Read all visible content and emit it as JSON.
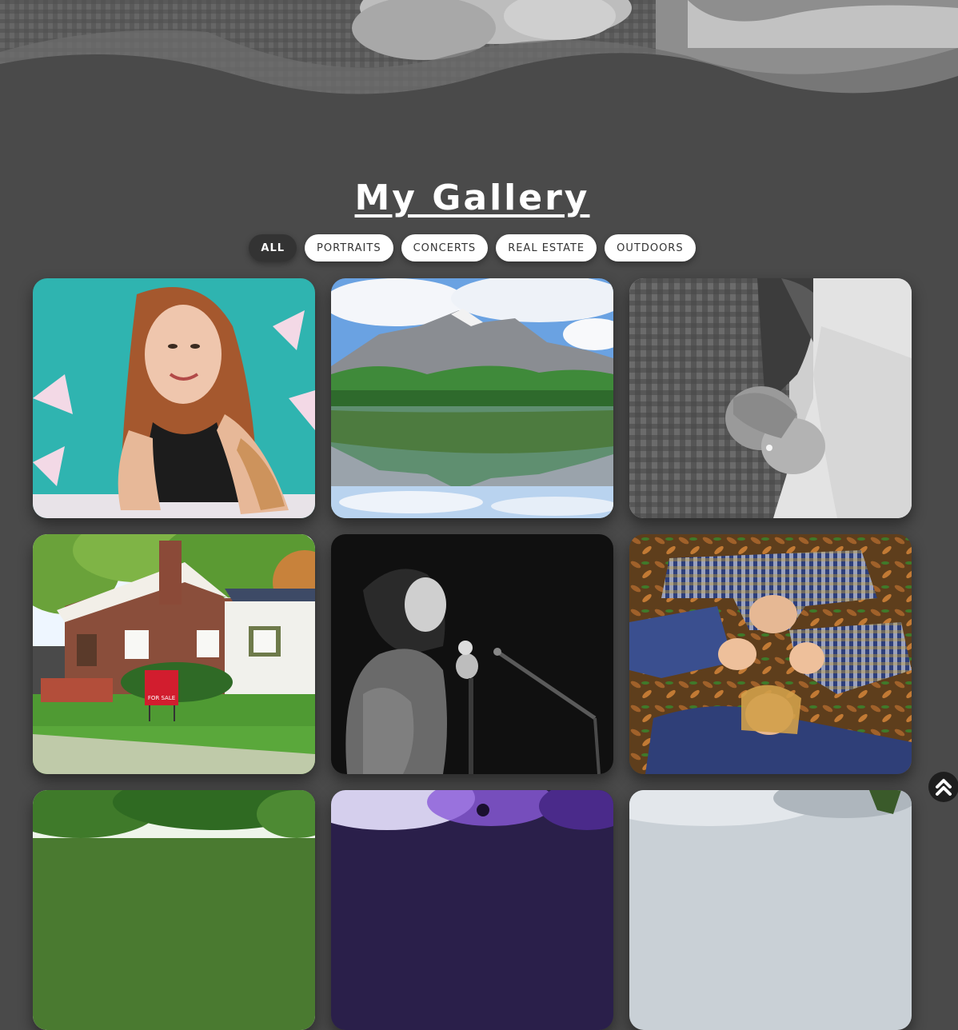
{
  "gallery": {
    "title": "My Gallery",
    "filters": [
      {
        "label": "ALL",
        "active": true
      },
      {
        "label": "PORTRAITS",
        "active": false
      },
      {
        "label": "CONCERTS",
        "active": false
      },
      {
        "label": "REAL ESTATE",
        "active": false
      },
      {
        "label": "OUTDOORS",
        "active": false
      }
    ],
    "images": [
      {
        "subject": "portrait-woman-teal-wall"
      },
      {
        "subject": "mountain-lake-reflection"
      },
      {
        "subject": "couple-holding-hands-bw"
      },
      {
        "subject": "brick-house-for-sale",
        "sign_text": "FOR SALE"
      },
      {
        "subject": "singer-microphone-bw"
      },
      {
        "subject": "family-lying-in-leaves"
      },
      {
        "subject": "trees-partial"
      },
      {
        "subject": "concert-lights-partial"
      },
      {
        "subject": "sky-partial"
      }
    ]
  },
  "back_to_top": {
    "icon": "double-chevron-up-icon"
  },
  "colors": {
    "page_bg": "#4a4a4a",
    "button_bg": "#ffffff",
    "active_button_bg": "#333333",
    "text": "#ffffff"
  }
}
